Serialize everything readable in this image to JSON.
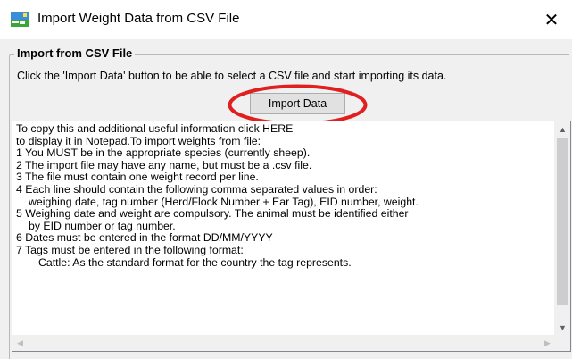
{
  "window": {
    "title": "Import Weight Data from CSV File",
    "close_glyph": "✕",
    "icon": "sheep-field-app-icon"
  },
  "group": {
    "legend": "Import from CSV File",
    "instruction": "Click the 'Import Data' button to be able to select a CSV file and start importing its data."
  },
  "import_button": {
    "label": "Import Data",
    "highlight_color": "#e02020"
  },
  "help_text": {
    "lines": [
      "To copy this and additional useful information click HERE",
      "to display it in Notepad.To import weights from file:",
      "1 You MUST be in the appropriate species (currently sheep).",
      "2 The import file may have any name, but must be a .csv file.",
      "3 The file must contain one weight record per line.",
      "4 Each line should contain the following comma separated values in order:",
      "weighing date, tag number (Herd/Flock Number + Ear Tag), EID number, weight.",
      "5 Weighing date and weight are compulsory. The animal must be identified either",
      "by EID number or tag number.",
      "6 Dates must be entered in the format DD/MM/YYYY",
      "7 Tags must be entered in the following format:",
      "Cattle: As the standard format for the country the tag represents."
    ]
  },
  "scrollbars": {
    "up_glyph": "▲",
    "down_glyph": "▼",
    "left_glyph": "◀",
    "right_glyph": "▶"
  }
}
